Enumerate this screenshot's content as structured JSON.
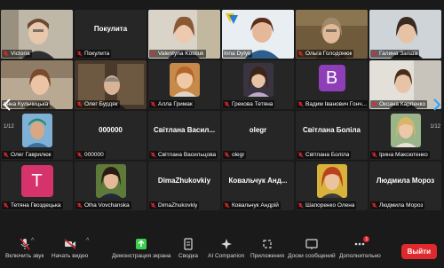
{
  "tiles": [
    {
      "id": "victoria",
      "name": "Victoria",
      "muted": true,
      "center": "",
      "avatar_letter": "",
      "speaking": false
    },
    {
      "id": "pokupka1",
      "name": "Покулита",
      "muted": true,
      "center": "Покулита",
      "avatar_letter": "",
      "speaking": false
    },
    {
      "id": "valentyna",
      "name": "Valentyna Kostiuk",
      "muted": true,
      "center": "",
      "avatar_letter": "",
      "speaking": false
    },
    {
      "id": "inna",
      "name": "Inna Dylyk",
      "muted": true,
      "center": "",
      "avatar_letter": "",
      "speaking": true
    },
    {
      "id": "olga-h",
      "name": "Ольга Голодонюк",
      "muted": true,
      "center": "",
      "avatar_letter": "",
      "speaking": false
    },
    {
      "id": "galyna",
      "name": "Галина Запша",
      "muted": true,
      "center": "",
      "avatar_letter": "",
      "speaking": false
    },
    {
      "id": "kulchytska",
      "name": "Анна Кульчицька",
      "muted": false,
      "center": "",
      "avatar_letter": "",
      "speaking": false
    },
    {
      "id": "burdiak",
      "name": "Олег Бурдяк",
      "muted": true,
      "center": "",
      "avatar_letter": "",
      "speaking": false
    },
    {
      "id": "grymak",
      "name": "Алла Гримак",
      "muted": true,
      "center": "",
      "avatar_letter": "",
      "speaking": false
    },
    {
      "id": "grekova",
      "name": "Грекова Тетяна",
      "muted": true,
      "center": "",
      "avatar_letter": "",
      "speaking": false
    },
    {
      "id": "vadym",
      "name": "Вадим Іванович Гонч...",
      "muted": true,
      "center": "",
      "avatar_letter": "B",
      "avatar_color": "#8e3fb8",
      "speaking": false
    },
    {
      "id": "oksana",
      "name": "Оксана Карпенко",
      "muted": true,
      "center": "",
      "avatar_letter": "",
      "speaking": false
    },
    {
      "id": "havryliuk",
      "name": "Олег Гаврилюк",
      "muted": true,
      "center": "",
      "avatar_letter": "",
      "speaking": false
    },
    {
      "id": "zeros",
      "name": "000000",
      "muted": true,
      "center": "000000",
      "avatar_letter": "",
      "speaking": false
    },
    {
      "id": "svitlana-v",
      "name": "Світлана Васильцова",
      "muted": true,
      "center": "Світлана Васил...",
      "avatar_letter": "",
      "speaking": false
    },
    {
      "id": "olegr",
      "name": "olegr",
      "muted": true,
      "center": "olegr",
      "avatar_letter": "",
      "speaking": false
    },
    {
      "id": "svitlana-b",
      "name": "Світлана Боліла",
      "muted": true,
      "center": "Світлана Боліла",
      "avatar_letter": "",
      "speaking": false
    },
    {
      "id": "iryna",
      "name": "Ірина Максютенко",
      "muted": true,
      "center": "",
      "avatar_letter": "",
      "speaking": false
    },
    {
      "id": "tetiana-g",
      "name": "Тетяна Гвоздецька",
      "muted": true,
      "center": "",
      "avatar_letter": "T",
      "avatar_color": "#d6336c",
      "speaking": false
    },
    {
      "id": "olha-v",
      "name": "Olha Vovchanska",
      "muted": true,
      "center": "",
      "avatar_letter": "",
      "speaking": false
    },
    {
      "id": "dima",
      "name": "DimaZhukovkiy",
      "muted": true,
      "center": "DimaZhukovkiy",
      "avatar_letter": "",
      "speaking": false
    },
    {
      "id": "kovalchuk",
      "name": "Ковальчук Андрій",
      "muted": true,
      "center": "Ковальчук Анд...",
      "avatar_letter": "",
      "speaking": false
    },
    {
      "id": "shaporenko",
      "name": "Шапоренко Олена",
      "muted": true,
      "center": "",
      "avatar_letter": "",
      "speaking": false
    },
    {
      "id": "moroz",
      "name": "Людмила Мороз",
      "muted": true,
      "center": "Людмила Мороз",
      "avatar_letter": "",
      "speaking": false
    }
  ],
  "pagination": {
    "left": "1/12",
    "right": "1/12"
  },
  "toolbar": {
    "audio": "Включить звук",
    "video": "Начать видео",
    "share": "Демонстрация экрана",
    "summary": "Сводка",
    "ai": "AI Companion",
    "apps": "Приложения",
    "whiteboards": "Доски сообщений",
    "more": "Дополнительно",
    "more_badge": "1",
    "leave": "Выйти"
  },
  "colors": {
    "accent_green": "#8fd14f",
    "share_green": "#3ccf4e",
    "leave_red": "#e0292c",
    "mute_red": "#e0292c"
  }
}
